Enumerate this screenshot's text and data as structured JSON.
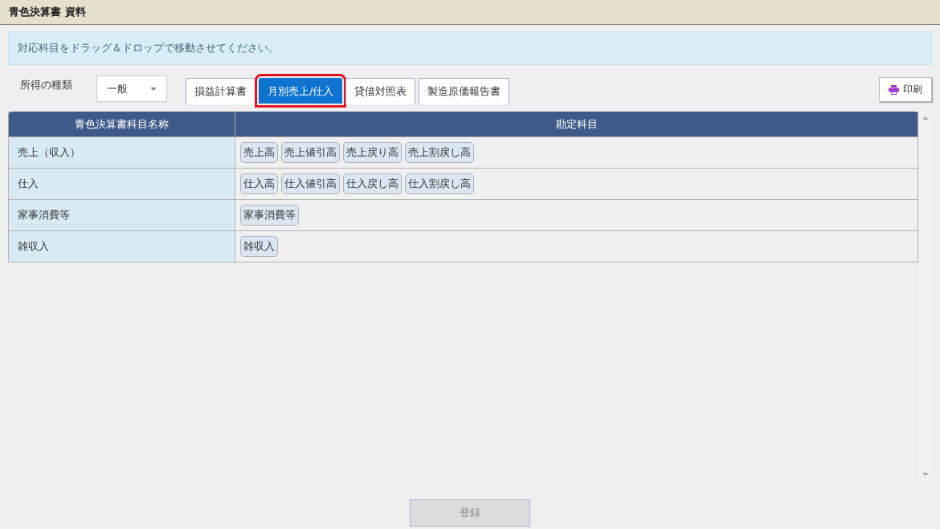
{
  "window": {
    "title": "青色決算書 資料"
  },
  "info": "対応科目をドラッグ＆ドロップで移動させてください。",
  "income_type": {
    "label": "所得の種類",
    "value": "一般"
  },
  "tabs": [
    {
      "label": "損益計算書",
      "selected": false,
      "highlighted": false
    },
    {
      "label": "月別売上/仕入",
      "selected": true,
      "highlighted": true
    },
    {
      "label": "貸借対照表",
      "selected": false,
      "highlighted": false
    },
    {
      "label": "製造原価報告書",
      "selected": false,
      "highlighted": false
    }
  ],
  "print_button": "印刷",
  "table": {
    "columns": [
      "青色決算書科目名称",
      "勘定科目"
    ],
    "rows": [
      {
        "name": "売上（収入）",
        "accounts": [
          "売上高",
          "売上値引高",
          "売上戻り高",
          "売上割戻し高"
        ]
      },
      {
        "name": "仕入",
        "accounts": [
          "仕入高",
          "仕入値引高",
          "仕入戻し高",
          "仕入割戻し高"
        ]
      },
      {
        "name": "家事消費等",
        "accounts": [
          "家事消費等"
        ]
      },
      {
        "name": "雑収入",
        "accounts": [
          "雑収入"
        ]
      }
    ]
  },
  "register_button": {
    "label": "登録",
    "disabled": true
  }
}
